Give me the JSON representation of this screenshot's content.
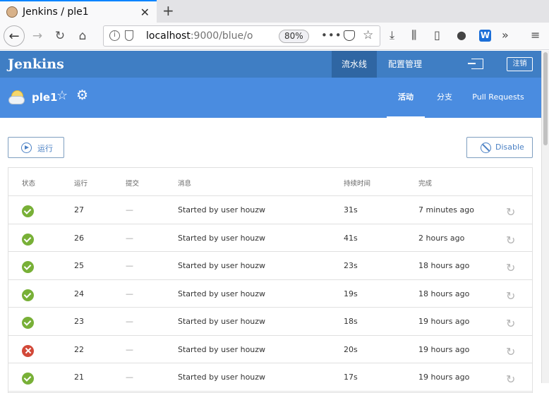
{
  "browser": {
    "tab_title": "Jenkins / ple1",
    "new_tab": "+",
    "url_host": "localhost",
    "url_rest": ":9000/blue/o",
    "zoom": "80%"
  },
  "jenkins": {
    "logo": "Jenkins",
    "nav": [
      "流水线",
      "配置管理"
    ],
    "logout": "注销"
  },
  "pipeline": {
    "name": "ple1",
    "tabs": [
      "活动",
      "分支",
      "Pull Requests"
    ]
  },
  "actions": {
    "run": "运行",
    "disable": "Disable"
  },
  "table": {
    "headers": [
      "状态",
      "运行",
      "提交",
      "消息",
      "持续时间",
      "完成"
    ],
    "rows": [
      {
        "status": "success",
        "run": "27",
        "commit": "—",
        "message": "Started by user houzw",
        "duration": "31s",
        "completed": "7 minutes ago"
      },
      {
        "status": "success",
        "run": "26",
        "commit": "—",
        "message": "Started by user houzw",
        "duration": "41s",
        "completed": "2 hours ago"
      },
      {
        "status": "success",
        "run": "25",
        "commit": "—",
        "message": "Started by user houzw",
        "duration": "23s",
        "completed": "18 hours ago"
      },
      {
        "status": "success",
        "run": "24",
        "commit": "—",
        "message": "Started by user houzw",
        "duration": "19s",
        "completed": "18 hours ago"
      },
      {
        "status": "success",
        "run": "23",
        "commit": "—",
        "message": "Started by user houzw",
        "duration": "18s",
        "completed": "19 hours ago"
      },
      {
        "status": "failure",
        "run": "22",
        "commit": "—",
        "message": "Started by user houzw",
        "duration": "20s",
        "completed": "19 hours ago"
      },
      {
        "status": "success",
        "run": "21",
        "commit": "—",
        "message": "Started by user houzw",
        "duration": "17s",
        "completed": "19 hours ago"
      }
    ]
  },
  "colors": {
    "header": "#3f7ec4",
    "subheader": "#4a8ce0",
    "success": "#78b037",
    "failure": "#d24939"
  }
}
